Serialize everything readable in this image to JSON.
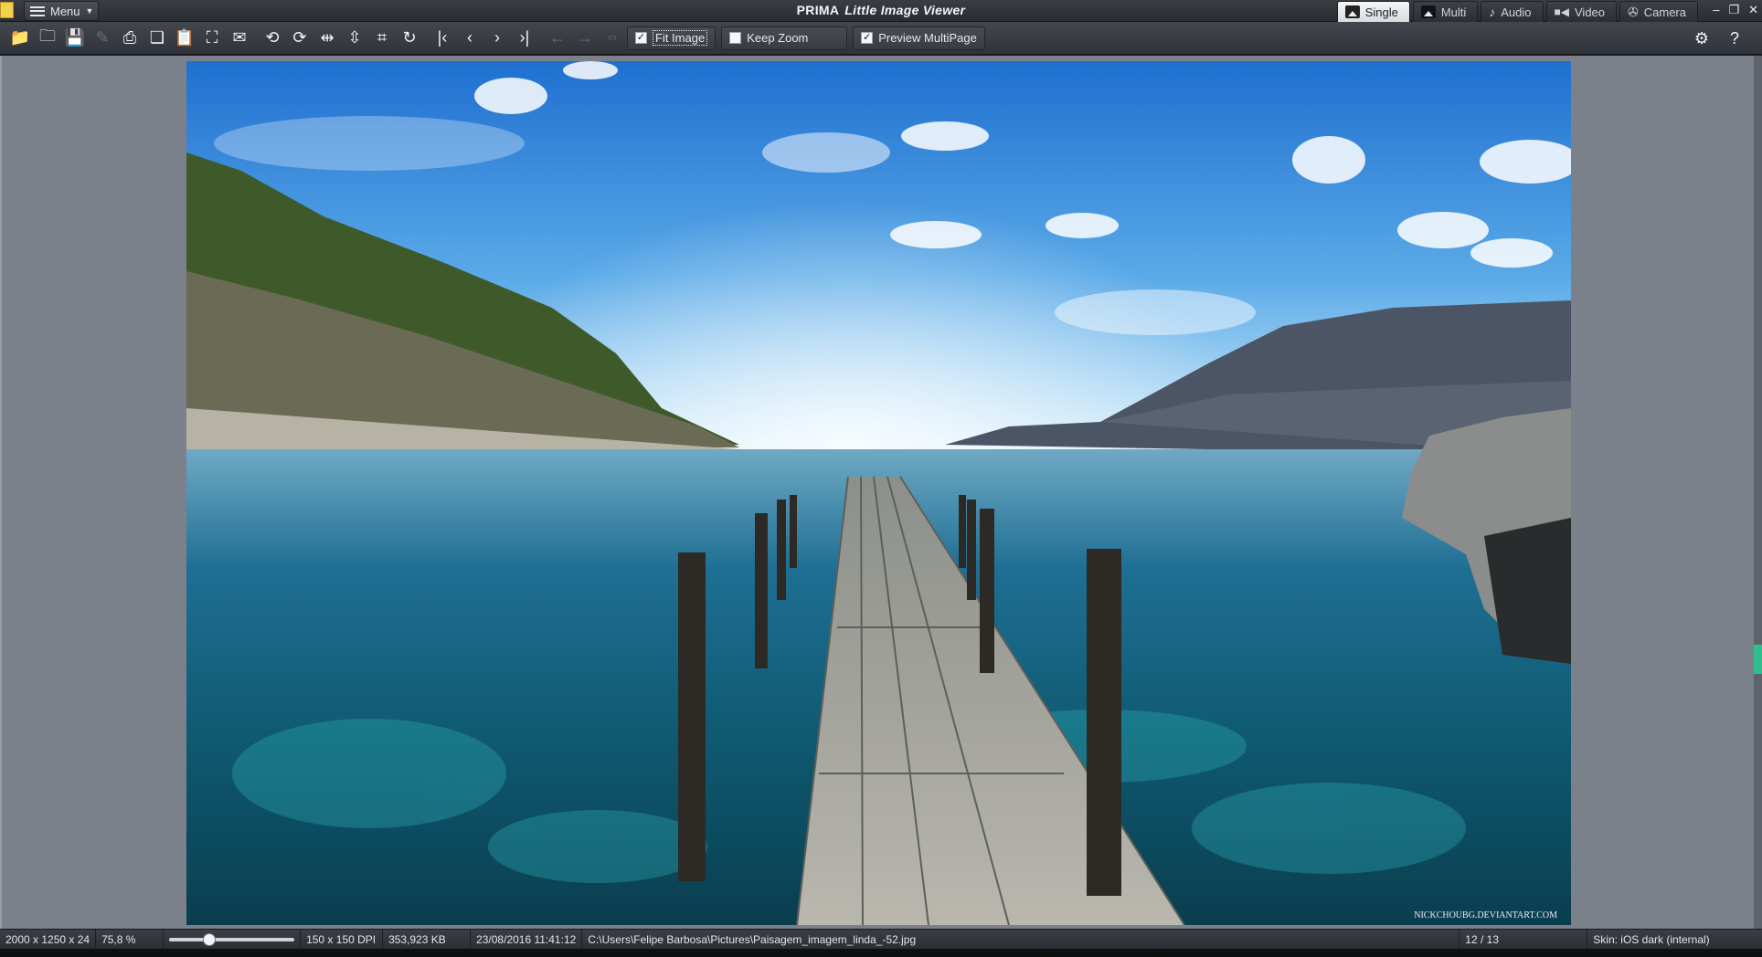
{
  "titlebar": {
    "menu_label": "Menu",
    "app_name": "PRIMA",
    "app_subtitle": "Little Image Viewer",
    "mode_tabs": [
      {
        "label": "Single",
        "active": true
      },
      {
        "label": "Multi",
        "active": false
      },
      {
        "label": "Audio",
        "active": false
      },
      {
        "label": "Video",
        "active": false
      },
      {
        "label": "Camera",
        "active": false
      }
    ]
  },
  "toolbar": {
    "fit_image_label": "Fit Image",
    "fit_image_checked": true,
    "keep_zoom_label": "Keep Zoom",
    "keep_zoom_checked": false,
    "preview_multipage_label": "Preview MultiPage",
    "preview_multipage_checked": true
  },
  "image": {
    "watermark": "NICKCHOUBG.DEVIANTART.COM"
  },
  "status": {
    "dimensions": "2000 x 1250 x 24",
    "zoom": "75,8 %",
    "zoom_level": 0.3,
    "dpi": "150 x 150 DPI",
    "file_size": "353,923 KB",
    "datetime": "23/08/2016 11:41:12",
    "path": "C:\\Users\\Felipe Barbosa\\Pictures\\Paisagem_imagem_linda_-52.jpg",
    "position": "12 / 13",
    "skin": "Skin: iOS dark (internal)"
  },
  "colors": {
    "accent_scroll": "#2fbf8f",
    "canvas_bg": "#7b818b"
  }
}
